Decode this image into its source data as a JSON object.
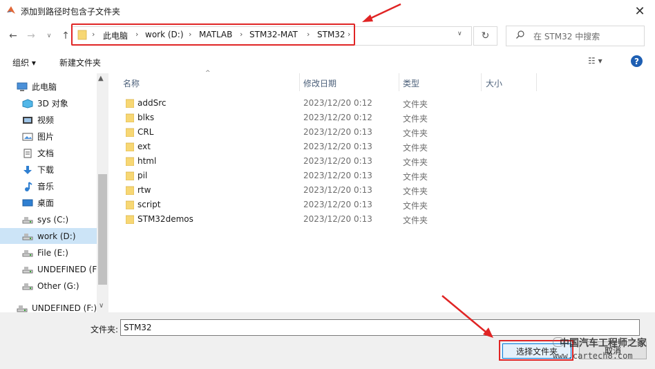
{
  "window": {
    "title": "添加到路径时包含子文件夹",
    "close": "✕"
  },
  "nav": {
    "back": "←",
    "forward": "→",
    "history": "∨",
    "up": "↑",
    "refresh": "↻",
    "dropdown": "∨"
  },
  "address": {
    "crumbs": [
      "此电脑",
      "work (D:)",
      "MATLAB",
      "STM32-MAT",
      "STM32"
    ],
    "separator": "›"
  },
  "search": {
    "placeholder": "在 STM32 中搜索"
  },
  "toolbar": {
    "organize": "组织 ▾",
    "new_folder": "新建文件夹",
    "view": "☷ ▾",
    "help": "?"
  },
  "sidebar": {
    "items": [
      {
        "label": "此电脑",
        "icon": "computer-icon"
      },
      {
        "label": "3D 对象",
        "icon": "cube-icon"
      },
      {
        "label": "视频",
        "icon": "video-icon"
      },
      {
        "label": "图片",
        "icon": "picture-icon"
      },
      {
        "label": "文档",
        "icon": "document-icon"
      },
      {
        "label": "下载",
        "icon": "download-icon"
      },
      {
        "label": "音乐",
        "icon": "music-icon"
      },
      {
        "label": "桌面",
        "icon": "desktop-icon"
      },
      {
        "label": "sys (C:)",
        "icon": "drive-icon"
      },
      {
        "label": "work (D:)",
        "icon": "drive-icon",
        "selected": true
      },
      {
        "label": "File (E:)",
        "icon": "drive-icon"
      },
      {
        "label": "UNDEFINED (F",
        "icon": "drive-icon"
      },
      {
        "label": "Other (G:)",
        "icon": "drive-icon"
      },
      {
        "label": "UNDEFINED (F:)",
        "icon": "drive-icon"
      }
    ],
    "scroll_up": "▲",
    "scroll_down": "∨"
  },
  "columns": {
    "name": "名称",
    "date": "修改日期",
    "type": "类型",
    "size": "大小",
    "sort_indicator": "^"
  },
  "files": [
    {
      "name": "addSrc",
      "date": "2023/12/20 0:12",
      "type": "文件夹"
    },
    {
      "name": "blks",
      "date": "2023/12/20 0:12",
      "type": "文件夹"
    },
    {
      "name": "CRL",
      "date": "2023/12/20 0:13",
      "type": "文件夹"
    },
    {
      "name": "ext",
      "date": "2023/12/20 0:13",
      "type": "文件夹"
    },
    {
      "name": "html",
      "date": "2023/12/20 0:13",
      "type": "文件夹"
    },
    {
      "name": "pil",
      "date": "2023/12/20 0:13",
      "type": "文件夹"
    },
    {
      "name": "rtw",
      "date": "2023/12/20 0:13",
      "type": "文件夹"
    },
    {
      "name": "script",
      "date": "2023/12/20 0:13",
      "type": "文件夹"
    },
    {
      "name": "STM32demos",
      "date": "2023/12/20 0:13",
      "type": "文件夹"
    }
  ],
  "bottom": {
    "folder_label": "文件夹:",
    "folder_value": "STM32",
    "select_button": "选择文件夹",
    "cancel_button": "取消"
  },
  "watermark": {
    "text": "中国汽车工程师之家",
    "url": "www.cartech8.com"
  },
  "colors": {
    "highlight": "#e02424",
    "accent": "#0078d7",
    "folder": "#f7d774"
  }
}
